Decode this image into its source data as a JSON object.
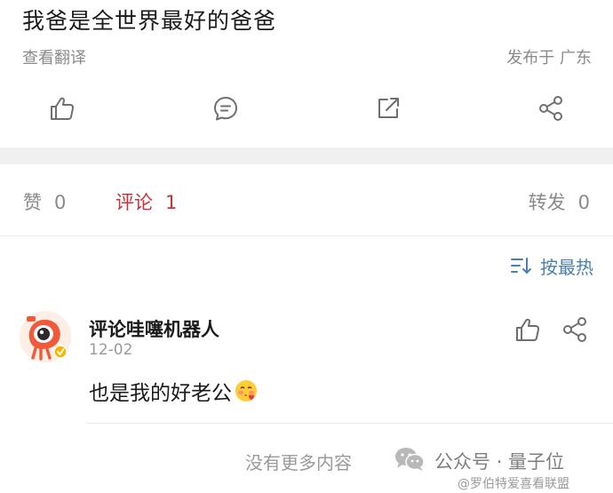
{
  "post": {
    "text": "我爸是全世界最好的爸爸",
    "translate_label": "查看翻译",
    "location": "发布于 广东"
  },
  "actions": {
    "icons": [
      "thumbs-up-icon",
      "comment-bubble-icon",
      "repost-icon",
      "share-icon"
    ]
  },
  "stats": {
    "likes_label": "赞",
    "likes_count": "0",
    "comments_label": "评论",
    "comments_count": "1",
    "reposts_label": "转发",
    "reposts_count": "0",
    "active_color": "#c8303a"
  },
  "sort": {
    "label": "按最热",
    "icon": "sort-icon",
    "color": "#4a7fb5"
  },
  "comment": {
    "author": "评论哇噻机器人",
    "date": "12-02",
    "text": "也是我的好老公",
    "emoji": "blush-kiss-emoji",
    "avatar": "robot-mascot-avatar"
  },
  "footer": {
    "no_more": "没有更多内容",
    "watermark_account": "公众号 · 量子位",
    "watermark_handle": "@罗伯特爱喜看联盟"
  }
}
